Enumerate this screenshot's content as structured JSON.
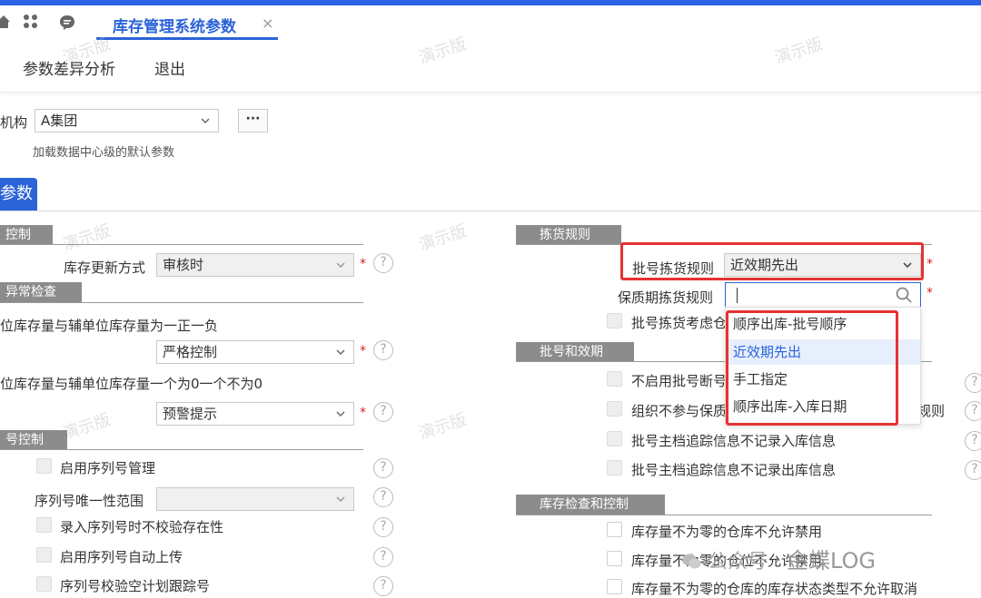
{
  "tabbar": {
    "home_icon": "home-icon",
    "apps_icon": "grid-icon",
    "chat_icon": "chat-icon",
    "active_tab": "库存管理系统参数",
    "close": "×"
  },
  "menu": {
    "items": [
      "参数差异分析",
      "退出"
    ]
  },
  "watermark": "演示版",
  "org": {
    "label": "机构",
    "value": "A集团",
    "more": "···",
    "hint": "加载数据中心级的默认参数"
  },
  "param_tab": "参数",
  "left": {
    "sec_control": "控制",
    "update_label": "库存更新方式",
    "update_value": "审核时",
    "sec_exception": "异常检查",
    "exc1_label": "位库存量与辅单位库存量为一正一负",
    "exc1_value": "严格控制",
    "exc2_label": "位库存量与辅单位库存量一个为0一个不为0",
    "exc2_value": "预警提示",
    "sec_serial": "号控制",
    "serial_items": [
      "启用序列号管理",
      "序列号唯一性范围",
      "录入序列号时不校验存在性",
      "启用序列号自动上传",
      "序列号校验空计划跟踪号"
    ]
  },
  "right": {
    "sec_pick": "拣货规则",
    "batch_pick_label": "批号拣货规则",
    "batch_pick_value": "近效期先出",
    "shelf_pick_label": "保质期拣货规则",
    "batch_consider": "批号拣货考虑仓",
    "dropdown_options": [
      "顺序出库-批号顺序",
      "近效期先出",
      "手工指定",
      "顺序出库-入库日期"
    ],
    "dropdown_selected": 1,
    "sec_batch": "批号和效期",
    "batch_items": [
      "不启用批号断号",
      "组织不参与保质",
      "批号主档追踪信息不记录入库信息",
      "批号主档追踪信息不记录出库信息"
    ],
    "batch_item2_tail": "规则",
    "sec_check": "库存检查和控制",
    "check_items": [
      "库存量不为零的仓库不允许禁用",
      "库存量不为零的仓位不允许禁用",
      "库存量不为零的仓库的库存状态类型不允许取消"
    ]
  },
  "wechat": {
    "prefix": "公众号 · ",
    "brand": "金蝶LOG"
  }
}
